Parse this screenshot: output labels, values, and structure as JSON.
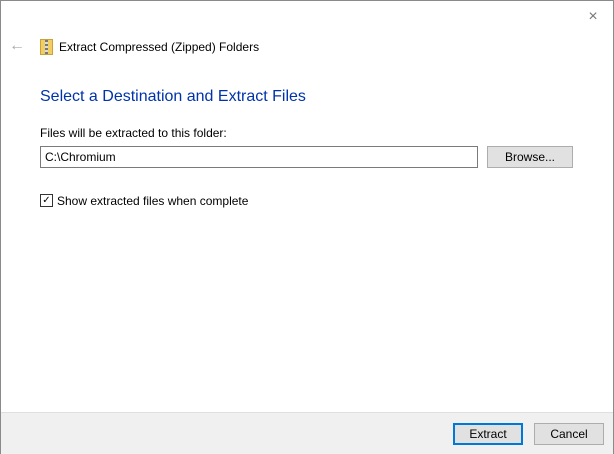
{
  "window": {
    "title": "Extract Compressed (Zipped) Folders",
    "close_icon": "×",
    "back_icon": "←"
  },
  "main": {
    "heading": "Select a Destination and Extract Files",
    "folder_label": "Files will be extracted to this folder:",
    "folder_value": "C:\\Chromium",
    "browse_label": "Browse...",
    "show_files_label": "Show extracted files when complete",
    "show_files_checked": true,
    "check_mark": "✓"
  },
  "footer": {
    "extract_label": "Extract",
    "cancel_label": "Cancel"
  },
  "colors": {
    "accent": "#0078d7",
    "heading": "#0033aa"
  }
}
